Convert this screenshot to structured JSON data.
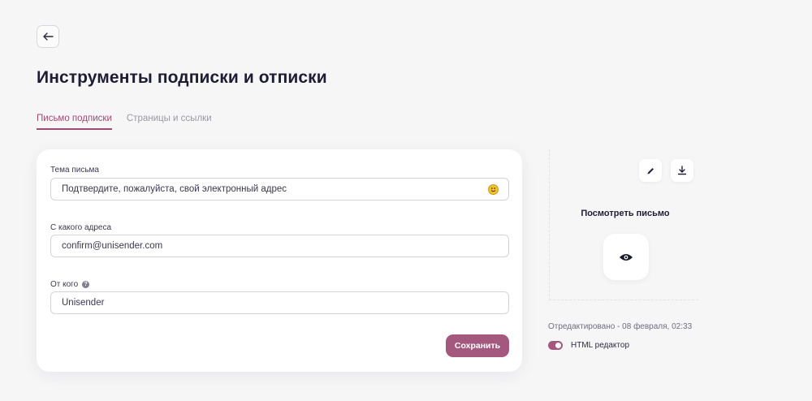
{
  "page": {
    "title": "Инструменты подписки и отписки"
  },
  "tabs": [
    {
      "label": "Письмо подписки",
      "active": true
    },
    {
      "label": "Страницы и ссылки",
      "active": false
    }
  ],
  "form": {
    "subject": {
      "label": "Тема письма",
      "value": "Подтвердите, пожалуйста, свой электронный адрес"
    },
    "from_address": {
      "label": "С какого адреса",
      "value": "confirm@unisender.com"
    },
    "from_name": {
      "label": "От кого",
      "value": "Unisender"
    },
    "save_label": "Сохранить"
  },
  "preview": {
    "title": "Посмотреть письмо",
    "edited": "Отредактировано - 08 февраля, 02:33",
    "html_editor_label": "HTML редактор",
    "html_editor_on": true
  },
  "colors": {
    "accent": "#a4587e",
    "background": "#f6f6f7",
    "title": "#1d1c33"
  }
}
